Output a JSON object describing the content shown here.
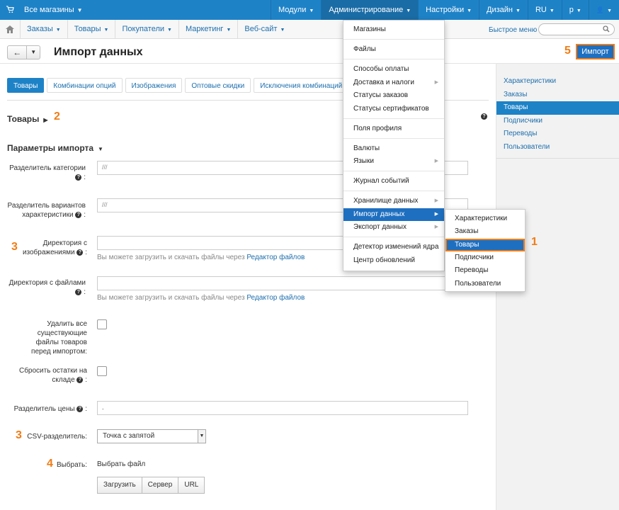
{
  "topbar": {
    "store_label": "Все магазины",
    "nav": [
      {
        "label": "Модули",
        "active": false
      },
      {
        "label": "Администрирование",
        "active": true
      },
      {
        "label": "Настройки",
        "active": false
      },
      {
        "label": "Дизайн",
        "active": false
      },
      {
        "label": "RU",
        "active": false
      },
      {
        "label": "р",
        "active": false
      },
      {
        "label": "",
        "active": false
      }
    ]
  },
  "navbar": {
    "items": [
      "Заказы",
      "Товары",
      "Покупатели",
      "Маркетинг",
      "Веб-сайт"
    ],
    "quick_menu": "Быстрое меню",
    "search_placeholder": ""
  },
  "header": {
    "title": "Импорт данных",
    "import_button": "Импорт"
  },
  "markers": {
    "m1": "1",
    "m2": "2",
    "m3a": "3",
    "m3b": "3",
    "m4": "4",
    "m5": "5"
  },
  "tabs": [
    "Товары",
    "Комбинации опций",
    "Изображения",
    "Оптовые скидки",
    "Исключения комбинаций опций"
  ],
  "sidebar": {
    "items": [
      {
        "label": "Характеристики",
        "active": false
      },
      {
        "label": "Заказы",
        "active": false
      },
      {
        "label": "Товары",
        "active": true
      },
      {
        "label": "Подписчики",
        "active": false
      },
      {
        "label": "Переводы",
        "active": false
      },
      {
        "label": "Пользователи",
        "active": false
      }
    ]
  },
  "form": {
    "section_title": "Товары",
    "params_title": "Параметры импорта",
    "category_delim_label": "Разделитель категории",
    "category_delim_value": "///",
    "variant_delim_label": "Разделитель вариантов характеристики",
    "variant_delim_value": "///",
    "images_dir_label": "Директория с изображениями",
    "images_dir_value": "",
    "files_dir_label": "Директория с файлами",
    "files_dir_value": "",
    "hint_text": "Вы можете загрузить и скачать файлы через",
    "hint_link": "Редактор файлов",
    "delete_files_label": "Удалить все существующие файлы товаров перед импортом:",
    "reset_stock_label": "Сбросить остатки на складе",
    "price_delim_label": "Разделитель цены",
    "price_delim_value": ".",
    "csv_delim_label": "CSV-разделитель:",
    "csv_delim_value": "Точка с запятой",
    "choose_label": "Выбрать:",
    "choose_file": "Выбрать файл",
    "upload_buttons": [
      "Загрузить",
      "Сервер",
      "URL"
    ]
  },
  "admin_menu": {
    "groups": [
      [
        "Магазины"
      ],
      [
        "Файлы"
      ],
      [
        "Способы оплаты",
        "Доставка и налоги",
        "Статусы заказов",
        "Статусы сертификатов"
      ],
      [
        "Поля профиля"
      ],
      [
        "Валюты",
        "Языки"
      ],
      [
        "Журнал событий"
      ],
      [
        "Хранилище данных",
        "Импорт данных",
        "Экспорт данных"
      ],
      [
        "Детектор изменений ядра",
        "Центр обновлений"
      ]
    ],
    "active": "Импорт данных",
    "with_submenu": [
      "Доставка и налоги",
      "Языки",
      "Хранилище данных",
      "Импорт данных",
      "Экспорт данных"
    ]
  },
  "import_submenu": {
    "items": [
      "Характеристики",
      "Заказы",
      "Товары",
      "Подписчики",
      "Переводы",
      "Пользователи"
    ],
    "active": "Товары"
  },
  "colors": {
    "brand": "#1e82c7",
    "accent": "#f07c16",
    "link": "#1e6fad"
  }
}
